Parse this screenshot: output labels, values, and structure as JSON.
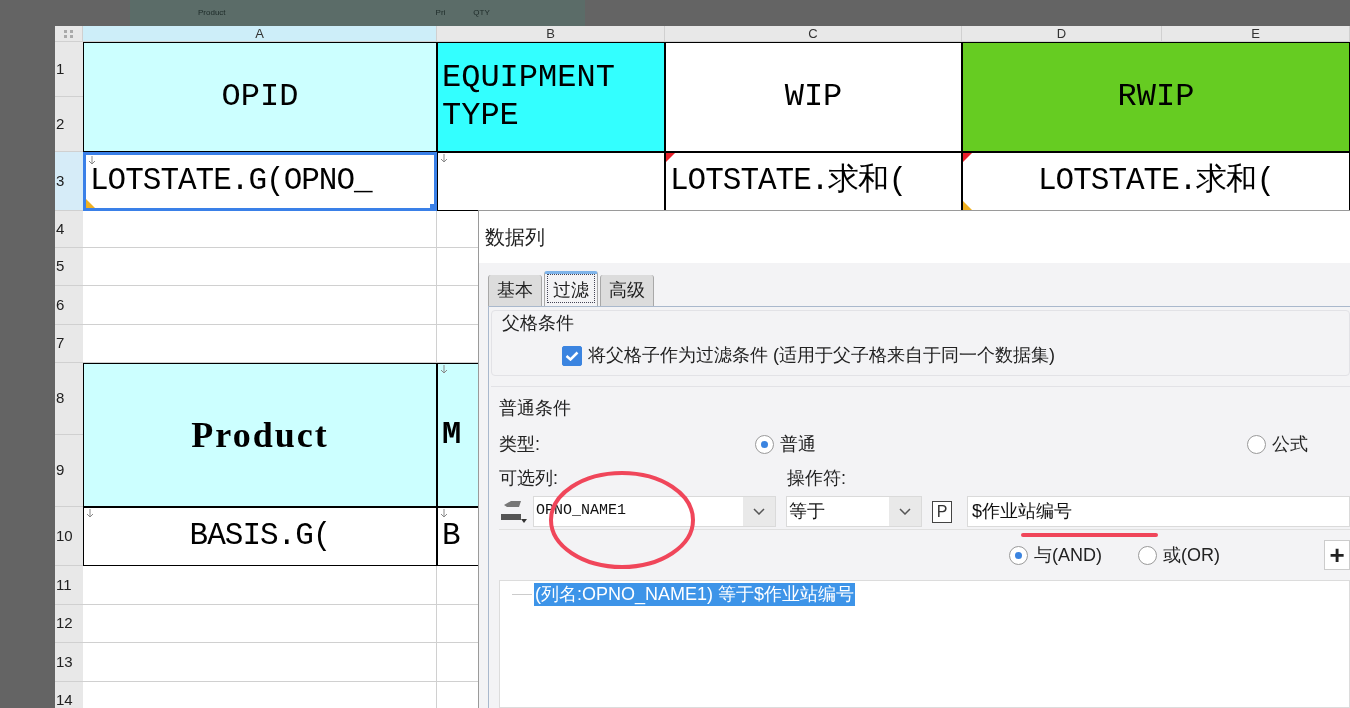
{
  "background_window": {
    "labels": [
      "Product",
      "Pri",
      "QTY"
    ]
  },
  "sheet": {
    "columns": [
      {
        "label": "A",
        "selected": true
      },
      {
        "label": "B",
        "selected": false
      },
      {
        "label": "C",
        "selected": false
      },
      {
        "label": "D",
        "selected": false
      },
      {
        "label": "E",
        "selected": false
      }
    ],
    "rows": [
      {
        "label": "1",
        "selected": false
      },
      {
        "label": "2",
        "selected": false
      },
      {
        "label": "3",
        "selected": true
      },
      {
        "label": "4",
        "selected": false
      },
      {
        "label": "5",
        "selected": false
      },
      {
        "label": "6",
        "selected": false
      },
      {
        "label": "7",
        "selected": false
      },
      {
        "label": "8",
        "selected": false
      },
      {
        "label": "9",
        "selected": false
      },
      {
        "label": "10",
        "selected": false
      },
      {
        "label": "11",
        "selected": false
      },
      {
        "label": "12",
        "selected": false
      },
      {
        "label": "13",
        "selected": false
      },
      {
        "label": "14",
        "selected": false
      }
    ],
    "cells": [
      {
        "text": "OPID",
        "color": "#ccffff",
        "selected": false
      },
      {
        "text": "EQUIPMENT TYPE",
        "color": "#33ffff",
        "selected": false
      },
      {
        "text": "WIP",
        "color": "#ffffff",
        "selected": false
      },
      {
        "text": "RWIP",
        "color": "#66cc22",
        "selected": false
      },
      {
        "text": "LOTSTATE.G(OPNO_",
        "color": "#ffffff",
        "selected": true
      },
      {
        "text": "LOTSTATE.求和(",
        "color": "#ffffff",
        "selected": false
      },
      {
        "text": "LOTSTATE.求和(",
        "color": "#ffffff",
        "selected": false
      },
      {
        "text": "Product",
        "color": "#ccffff",
        "selected": false
      },
      {
        "text": "M",
        "color": "#ccffff",
        "selected": false
      },
      {
        "text": "BASIS.G(",
        "color": "#ffffff",
        "selected": false
      },
      {
        "text": "B",
        "color": "#ffffff",
        "selected": false
      }
    ]
  },
  "dialog": {
    "title": "数据列",
    "tabs": [
      {
        "label": "基本",
        "selected": false
      },
      {
        "label": "过滤",
        "selected": true
      },
      {
        "label": "高级",
        "selected": false
      }
    ],
    "parent_condition": {
      "legend": "父格条件",
      "checkbox": {
        "label": "将父格子作为过滤条件 (适用于父子格来自于同一个数据集)",
        "checked": true
      }
    },
    "normal_condition": {
      "legend": "普通条件",
      "type_label": "类型:",
      "type_options": [
        {
          "label": "普通",
          "selected": true
        },
        {
          "label": "公式",
          "selected": false
        }
      ],
      "column_label": "可选列:",
      "column_value": "OPNO_NAME1",
      "operator_label": "操作符:",
      "operator_value": "等于",
      "parameter_button": "P",
      "value": "$作业站编号",
      "logic_options": [
        {
          "label": "与(AND)",
          "selected": true
        },
        {
          "label": "或(OR)",
          "selected": false
        }
      ],
      "add_button": "+",
      "conditions": [
        {
          "text": "(列名:OPNO_NAME1) 等于$作业站编号",
          "selected": true
        }
      ]
    }
  }
}
